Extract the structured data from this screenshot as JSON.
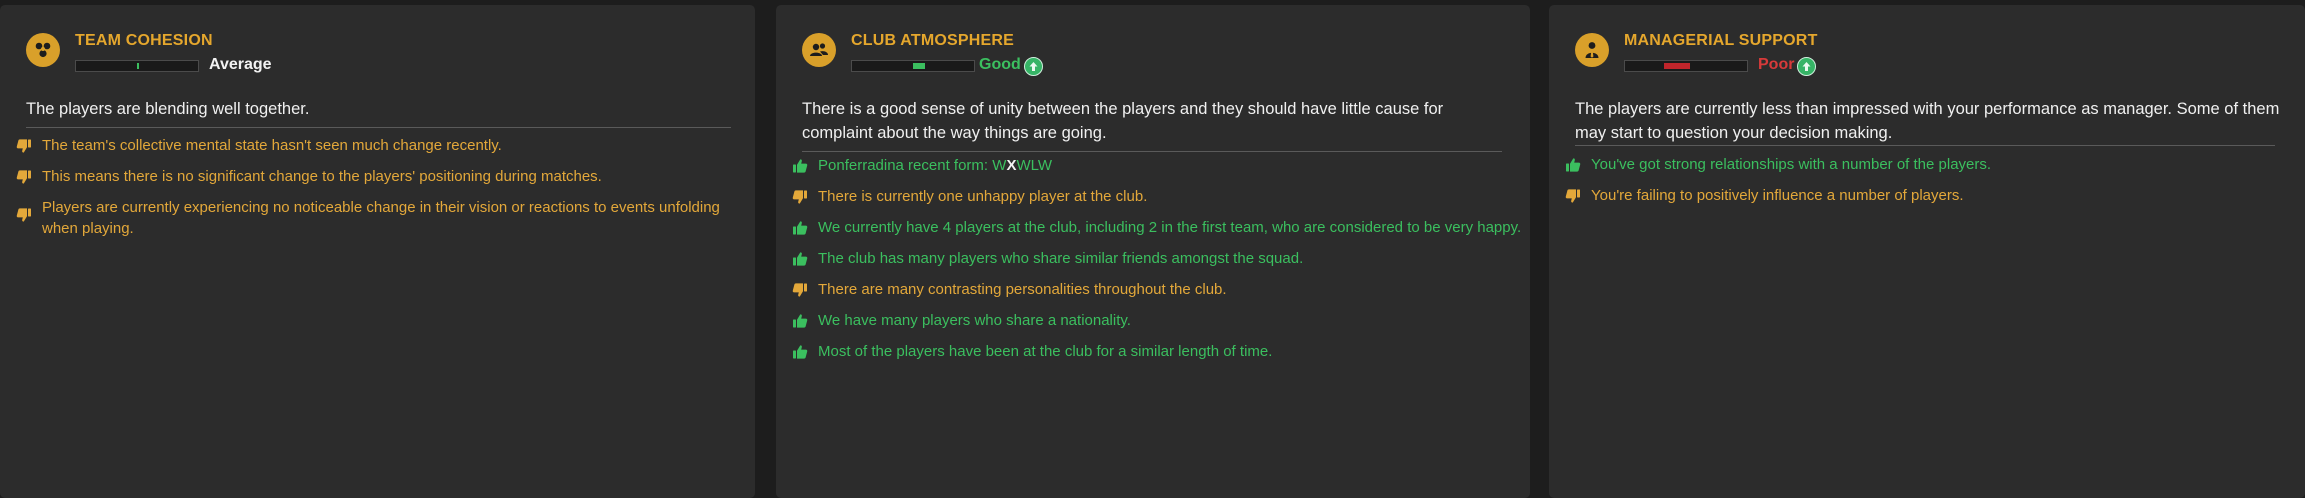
{
  "panels": [
    {
      "title": "TEAM COHESION",
      "icon": "cohesion-icon",
      "rating": "Average",
      "rating_color": "#f2f2f2",
      "meter_level": 0.52,
      "meter_color": "#3bbf5f",
      "description": "The players are blending well together.",
      "facts": [
        {
          "type": "negative",
          "text": "The team's collective mental state hasn't seen much change recently."
        },
        {
          "type": "negative",
          "text": "This means there is no significant change to the players' positioning during matches."
        },
        {
          "type": "negative",
          "text": "Players are currently experiencing no noticeable change in their vision or reactions to events unfolding when playing."
        }
      ]
    },
    {
      "title": "CLUB ATMOSPHERE",
      "icon": "group-icon",
      "rating": "Good",
      "rating_color": "#3bbf5f",
      "trend": "up-arrow-icon",
      "meter_level": 0.6,
      "meter_color": "#3bbf5f",
      "description": "There is a good sense of unity between the players and they should have little cause for complaint about the way things are going.",
      "form_label": "Ponferradina recent form:",
      "form": [
        "W",
        "X",
        "W",
        "L",
        "W"
      ],
      "facts": [
        {
          "type": "negative",
          "text": "There is currently one unhappy player at the club."
        },
        {
          "type": "positive",
          "text": "We currently have 4 players at the club, including 2 in the first team, who are considered to be very happy."
        },
        {
          "type": "positive",
          "text": "The club has many players who share similar friends amongst the squad."
        },
        {
          "type": "negative",
          "text": "There are many contrasting personalities throughout the club."
        },
        {
          "type": "positive",
          "text": "We have many players who share a nationality."
        },
        {
          "type": "positive",
          "text": "Most of the players have been at the club for a similar length of time."
        }
      ]
    },
    {
      "title": "MANAGERIAL SUPPORT",
      "icon": "manager-icon",
      "rating": "Poor",
      "rating_color": "#d83a3a",
      "trend": "up-arrow-icon",
      "meter_level": 0.33,
      "meter_color": "#c0252b",
      "description": "The players are currently less than impressed with your performance as manager. Some of them may start to question your decision making.",
      "facts": [
        {
          "type": "positive",
          "text": "You've got strong relationships with a number of the players."
        },
        {
          "type": "negative",
          "text": "You're failing to positively influence a number of players."
        }
      ]
    }
  ],
  "colors": {
    "positive": "#3bbf5f",
    "negative": "#e3a83a",
    "title": "#e5a72d",
    "panel_bg": "#2c2c2c"
  }
}
